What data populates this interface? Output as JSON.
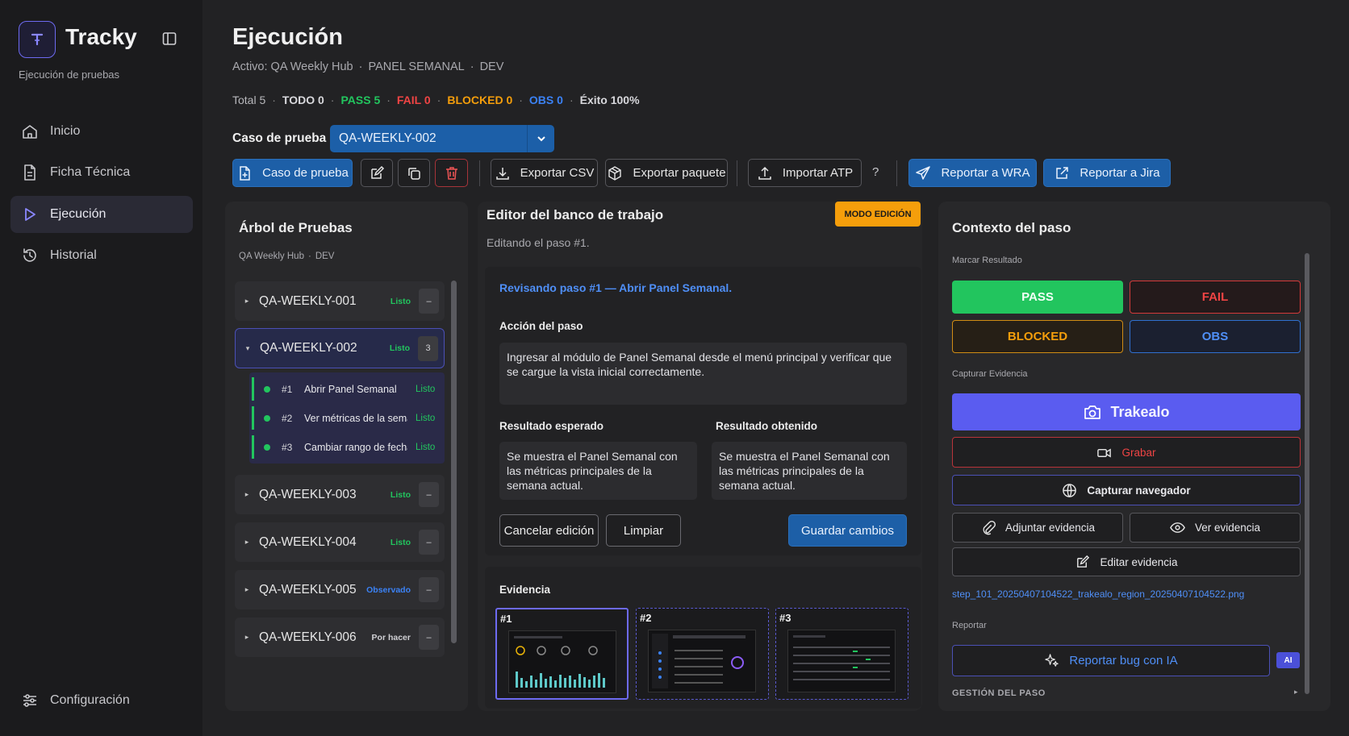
{
  "app": {
    "name": "Tracky",
    "subtitle": "Ejecución de pruebas"
  },
  "sidebar": {
    "items": [
      {
        "label": "Inicio",
        "icon": "home-icon"
      },
      {
        "label": "Ficha Técnica",
        "icon": "document-icon"
      },
      {
        "label": "Ejecución",
        "icon": "play-icon",
        "active": true
      },
      {
        "label": "Historial",
        "icon": "history-icon"
      }
    ],
    "settings_label": "Configuración"
  },
  "header": {
    "title": "Ejecución",
    "active_prefix": "Activo: QA Weekly Hub",
    "panel": "PANEL SEMANAL",
    "env": "DEV",
    "dot": "·",
    "stats": {
      "total": "Total 5",
      "todo": "TODO 0",
      "pass": "PASS 5",
      "fail": "FAIL 0",
      "blocked": "BLOCKED 0",
      "obs": "OBS 0",
      "success": "Éxito 100%"
    }
  },
  "case": {
    "label": "Caso de prueba",
    "selected": "QA-WEEKLY-002"
  },
  "toolbar": {
    "case_btn": "Caso de prueba",
    "export_csv": "Exportar CSV",
    "export_pkg": "Exportar paquete",
    "import_atp": "Importar ATP",
    "help": "?",
    "report_wra": "Reportar a WRA",
    "report_jira": "Reportar a Jira"
  },
  "tree": {
    "title": "Árbol de Pruebas",
    "meta_project": "QA Weekly Hub",
    "meta_env": "DEV",
    "items": [
      {
        "name": "QA-WEEKLY-001",
        "status": "Listo",
        "count": "–"
      },
      {
        "name": "QA-WEEKLY-002",
        "status": "Listo",
        "count": "3"
      },
      {
        "name": "QA-WEEKLY-003",
        "status": "Listo",
        "count": "–"
      },
      {
        "name": "QA-WEEKLY-004",
        "status": "Listo",
        "count": "–"
      },
      {
        "name": "QA-WEEKLY-005",
        "status": "Observado",
        "count": "–"
      },
      {
        "name": "QA-WEEKLY-006",
        "status": "Por hacer",
        "count": "–"
      }
    ],
    "steps": [
      {
        "num": "#1",
        "name": "Abrir Panel Semanal",
        "status": "Listo"
      },
      {
        "num": "#2",
        "name": "Ver métricas de la seman",
        "status": "Listo"
      },
      {
        "num": "#3",
        "name": "Cambiar rango de fechas",
        "status": "Listo"
      }
    ]
  },
  "editor": {
    "title": "Editor del banco de trabajo",
    "badge": "MODO EDICIÓN",
    "subtitle": "Editando el paso #1.",
    "reviewing": "Revisando paso #1 — Abrir Panel Semanal.",
    "action_label": "Acción del paso",
    "action_text": "Ingresar al módulo de Panel Semanal desde el menú principal y verificar que se cargue la vista inicial correctamente.",
    "expected_label": "Resultado esperado",
    "expected_text": "Se muestra el Panel Semanal con las métricas principales de la semana actual.",
    "obtained_label": "Resultado obtenido",
    "obtained_text": "Se muestra el Panel Semanal con las métricas principales de la semana actual.",
    "cancel": "Cancelar edición",
    "clear": "Limpiar",
    "save": "Guardar cambios",
    "evidence_label": "Evidencia",
    "thumbs": [
      "#1",
      "#2",
      "#3"
    ]
  },
  "context": {
    "title": "Contexto del paso",
    "mark_label": "Marcar Resultado",
    "pass": "PASS",
    "fail": "FAIL",
    "blocked": "BLOCKED",
    "obs": "OBS",
    "capture_label": "Capturar Evidencia",
    "trakealo": "Trakealo",
    "record": "Grabar",
    "capture_browser": "Capturar navegador",
    "attach": "Adjuntar evidencia",
    "view": "Ver evidencia",
    "edit": "Editar evidencia",
    "file": "step_101_20250407104522_trakealo_region_20250407104522.png",
    "report_label": "Reportar",
    "report_ai": "Reportar bug con IA",
    "ai_badge": "AI",
    "step_mgmt": "GESTIÓN DEL PASO"
  },
  "colors": {
    "pass": "#22c55e",
    "fail": "#ef4444",
    "blocked": "#f59e0b",
    "obs": "#3b82f6",
    "accent": "#6366f1"
  }
}
